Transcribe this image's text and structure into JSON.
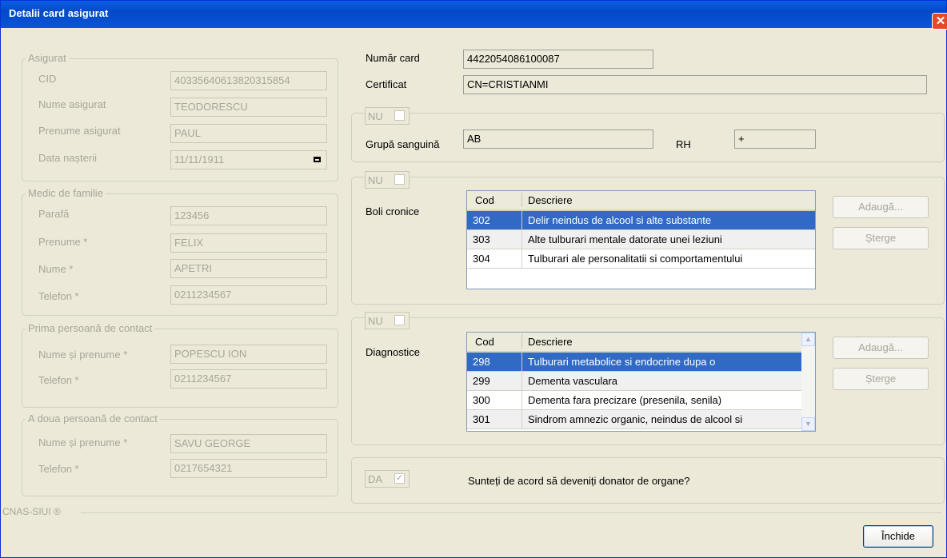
{
  "window": {
    "title": "Detalii card asigurat",
    "close_glyph": "✕"
  },
  "asigurat": {
    "legend": "Asigurat",
    "cid_label": "CID",
    "cid": "40335640613820315854",
    "nume_label": "Nume asigurat",
    "nume": "TEODORESCU",
    "prenume_label": "Prenume asigurat",
    "prenume": "PAUL",
    "data_label": "Data nașterii",
    "data": "11/11/1911"
  },
  "medic": {
    "legend": "Medic de familie",
    "parafa_label": "Parafă",
    "parafa": "123456",
    "prenume_label": "Prenume *",
    "prenume": "FELIX",
    "nume_label": "Nume *",
    "nume": "APETRI",
    "telefon_label": "Telefon *",
    "telefon": "0211234567"
  },
  "contact1": {
    "legend": "Prima persoană de contact",
    "nume_label": "Nume și prenume *",
    "nume": "POPESCU ION",
    "telefon_label": "Telefon *",
    "telefon": "0211234567"
  },
  "contact2": {
    "legend": "A doua persoană de contact",
    "nume_label": "Nume și prenume *",
    "nume": "SAVU GEORGE",
    "telefon_label": "Telefon *",
    "telefon": "0217654321"
  },
  "card": {
    "numar_label": "Număr card",
    "numar": "4422054086100087",
    "cert_label": "Certificat",
    "cert": "CN=CRISTIANMI"
  },
  "sange": {
    "toggle": "NU",
    "grupa_label": "Grupă sanguină",
    "grupa": "AB",
    "rh_label": "RH",
    "rh": "+"
  },
  "boli": {
    "toggle": "NU",
    "label": "Boli cronice",
    "col_cod": "Cod",
    "col_desc": "Descriere",
    "rows": [
      {
        "cod": "302",
        "desc": "Delir neindus de alcool si alte substante"
      },
      {
        "cod": "303",
        "desc": "Alte tulburari mentale datorate unei leziuni"
      },
      {
        "cod": "304",
        "desc": "Tulburari ale personalitatii si comportamentului"
      }
    ],
    "add": "Adaugă...",
    "del": "Șterge"
  },
  "diag": {
    "toggle": "NU",
    "label": "Diagnostice",
    "col_cod": "Cod",
    "col_desc": "Descriere",
    "rows": [
      {
        "cod": "298",
        "desc": "Tulburari metabolice si endocrine dupa o"
      },
      {
        "cod": "299",
        "desc": "Dementa vasculara"
      },
      {
        "cod": "300",
        "desc": "Dementa fara precizare (presenila, senila)"
      },
      {
        "cod": "301",
        "desc": "Sindrom amnezic organic, neindus de alcool si"
      }
    ],
    "add": "Adaugă...",
    "del": "Șterge"
  },
  "donor": {
    "toggle": "DA",
    "question": "Sunteți de acord să deveniți donator de organe?",
    "checked_glyph": "✓"
  },
  "footer": {
    "brand": "CNAS-SIUI ®",
    "close": "Închide"
  },
  "icons": {
    "scroll_up": "▲",
    "scroll_down": "▼"
  }
}
